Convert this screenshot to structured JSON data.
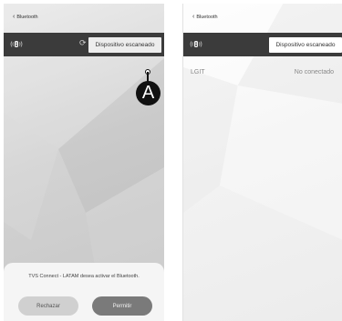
{
  "left_screen": {
    "back_label": "Bluetooth",
    "scan_button": "Dispositivo escaneado",
    "callout_label": "A",
    "dialog": {
      "message": "TVS Connect - LATAM desea activar el Bluetooth.",
      "reject_label": "Rechazar",
      "allow_label": "Permitir"
    }
  },
  "right_screen": {
    "back_label": "Bluetooth",
    "scan_button": "Dispositivo escaneado",
    "device": {
      "name": "LGIT",
      "status": "No conectado"
    }
  },
  "icons": {
    "back": "chevron-left-icon",
    "bluetooth": "bluetooth-speaker-icon",
    "refresh": "refresh-icon"
  }
}
